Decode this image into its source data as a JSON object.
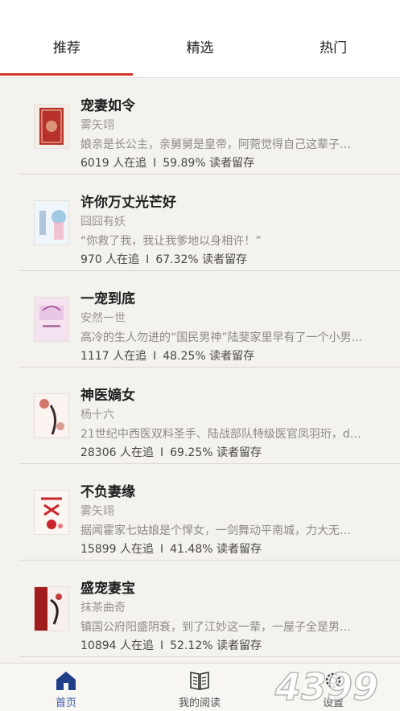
{
  "tabs": [
    {
      "label": "推荐",
      "active": true
    },
    {
      "label": "精选",
      "active": false
    },
    {
      "label": "热门",
      "active": false
    }
  ],
  "books": [
    {
      "title": "宠妻如令",
      "author": "雾矢翊",
      "desc": "娘亲是长公主，亲舅舅是皇帝，阿菀觉得自己这辈子…",
      "readers": "6019 人在追",
      "retention": "59.89% 读者留存",
      "cover_color": "#b7302b"
    },
    {
      "title": "许你万丈光芒好",
      "author": "囧囧有妖",
      "desc": "“你救了我，我让我爹地以身相许！”",
      "readers": "970 人在追",
      "retention": "67.32% 读者留存",
      "cover_color": "#7fb7d9"
    },
    {
      "title": "一宠到底",
      "author": "安然一世",
      "desc": "高冷的生人勿进的“国民男神”陆斐家里早有了一个小男…",
      "readers": "1117 人在追",
      "retention": "48.25% 读者留存",
      "cover_color": "#e9c6e4"
    },
    {
      "title": "神医嫡女",
      "author": "杨十六",
      "desc": "21世纪中西医双料圣手、陆战部队特级医官凤羽珩，d…",
      "readers": "28306 人在追",
      "retention": "69.25% 读者留存",
      "cover_color": "#c9574a"
    },
    {
      "title": "不负妻缘",
      "author": "雾矢翊",
      "desc": "据闻霍家七姑娘是个悍女，一剑舞动平南城，力大无…",
      "readers": "15899 人在追",
      "retention": "41.48% 读者留存",
      "cover_color": "#c8262a"
    },
    {
      "title": "盛宠妻宝",
      "author": "抹茶曲奇",
      "desc": "镇国公府阳盛阴衰，到了江妙这一辈，一屋子全是男…",
      "readers": "10894 人在追",
      "retention": "52.12% 读者留存",
      "cover_color": "#a11d1d"
    }
  ],
  "stats_separator": "I",
  "bottom_nav": [
    {
      "label": "首页",
      "icon": "home-icon",
      "active": true
    },
    {
      "label": "我的阅读",
      "icon": "book-icon",
      "active": false
    },
    {
      "label": "设置",
      "icon": "gear-icon",
      "active": false
    }
  ],
  "watermark": "4399",
  "colors": {
    "accent": "#d0342c",
    "nav_active": "#3b5aa6",
    "background": "#f4f2ee"
  }
}
